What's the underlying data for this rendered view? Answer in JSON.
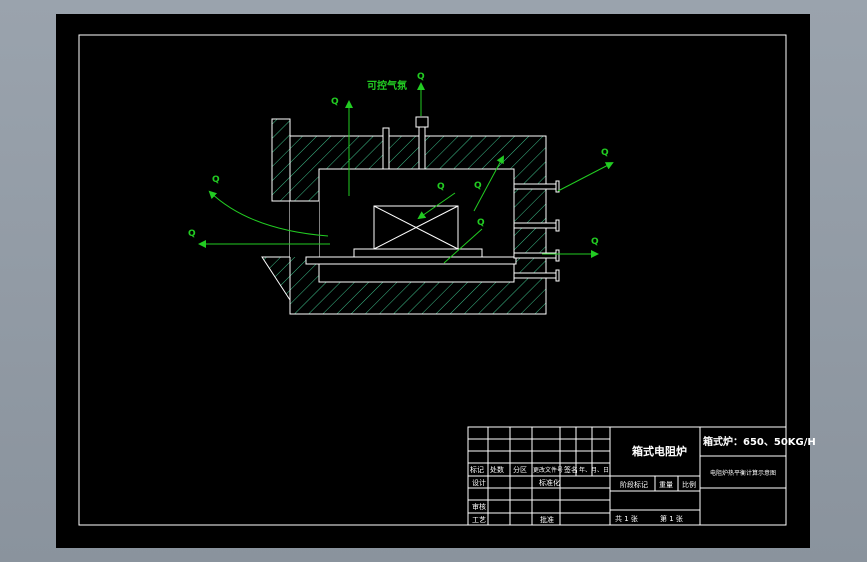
{
  "colors": {
    "background": "#9aa3ad",
    "paper": "#000000",
    "line": "#ffffff",
    "annotation": "#22cc22",
    "hatch": "#3dbf8a"
  },
  "labels": {
    "gas_note": "可控气氛",
    "q_left_top": "Q",
    "q_left": "Q",
    "q_top": "Q",
    "q_center": "Q",
    "q_top_center": "Q",
    "q_right_mid": "Q",
    "q_right_top": "Q",
    "q_right": "Q",
    "q_upper": "Q"
  },
  "title_block": {
    "name": "箱式电阻炉",
    "spec": "箱式炉：650、50KG/H",
    "drawing_title": "电阻炉热平衡计算示意图",
    "sheet_total": "共 1 张",
    "sheet_no": "第 1 张",
    "rev_headers": [
      "标记",
      "处数",
      "分区",
      "更改文件号",
      "签名",
      "年、月、日"
    ],
    "design": "设计",
    "standardization": "标准化",
    "review": "审核",
    "process": "工艺",
    "approve": "批准",
    "stage_mark": "阶段标记",
    "weight": "重量",
    "scale": "比例"
  }
}
